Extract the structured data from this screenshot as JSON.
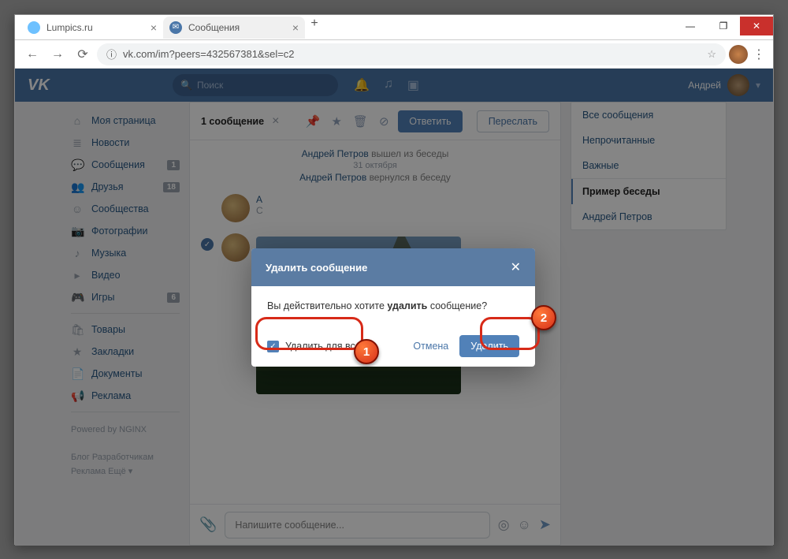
{
  "browser": {
    "tabs": [
      {
        "title": "Lumpics.ru"
      },
      {
        "title": "Сообщения"
      }
    ],
    "new_tab": "+",
    "url": "vk.com/im?peers=432567381&sel=c2"
  },
  "win": {
    "min": "—",
    "max": "❐",
    "close": "✕"
  },
  "vk": {
    "logo": "VK",
    "search_placeholder": "Поиск",
    "username": "Андрей",
    "headicons": {
      "bell": "🔔",
      "music": "♫",
      "video": "▣"
    }
  },
  "nav": {
    "items": [
      {
        "icon": "⌂",
        "label": "Моя страница"
      },
      {
        "icon": "≣",
        "label": "Новости"
      },
      {
        "icon": "💬",
        "label": "Сообщения",
        "badge": "1"
      },
      {
        "icon": "👥",
        "label": "Друзья",
        "badge": "18"
      },
      {
        "icon": "☺",
        "label": "Сообщества"
      },
      {
        "icon": "📷",
        "label": "Фотографии"
      },
      {
        "icon": "♪",
        "label": "Музыка"
      },
      {
        "icon": "▸",
        "label": "Видео"
      },
      {
        "icon": "🎮",
        "label": "Игры",
        "badge": "6"
      }
    ],
    "items2": [
      {
        "icon": "🛍",
        "label": "Товары"
      },
      {
        "icon": "★",
        "label": "Закладки"
      },
      {
        "icon": "📄",
        "label": "Документы"
      },
      {
        "icon": "📢",
        "label": "Реклама"
      }
    ],
    "powered": "Powered by NGINX",
    "foot1": "Блог   Разработчикам",
    "foot2": "Реклама   Ещё ▾"
  },
  "main": {
    "selected": "1 сообщение",
    "reply": "Ответить",
    "forward": "Переслать",
    "sys1_name": "Андрей Петров",
    "sys1_act": " вышел из беседы",
    "sys_date": "31 октября",
    "sys2_name": "Андрей Петров",
    "sys2_act": " вернулся в беседу",
    "compose_ph": "Напишите сообщение..."
  },
  "right": {
    "all": "Все сообщения",
    "unread": "Непрочитанные",
    "important": "Важные",
    "ex": "Пример беседы",
    "person": "Андрей Петров"
  },
  "modal": {
    "title": "Удалить сообщение",
    "close": "✕",
    "q1": "Вы действительно хотите ",
    "q2": "удалить",
    "q3": " сообщение?",
    "chk": "Удалить для всех",
    "cancel": "Отмена",
    "delete": "Удалить"
  },
  "ann": {
    "one": "1",
    "two": "2"
  }
}
